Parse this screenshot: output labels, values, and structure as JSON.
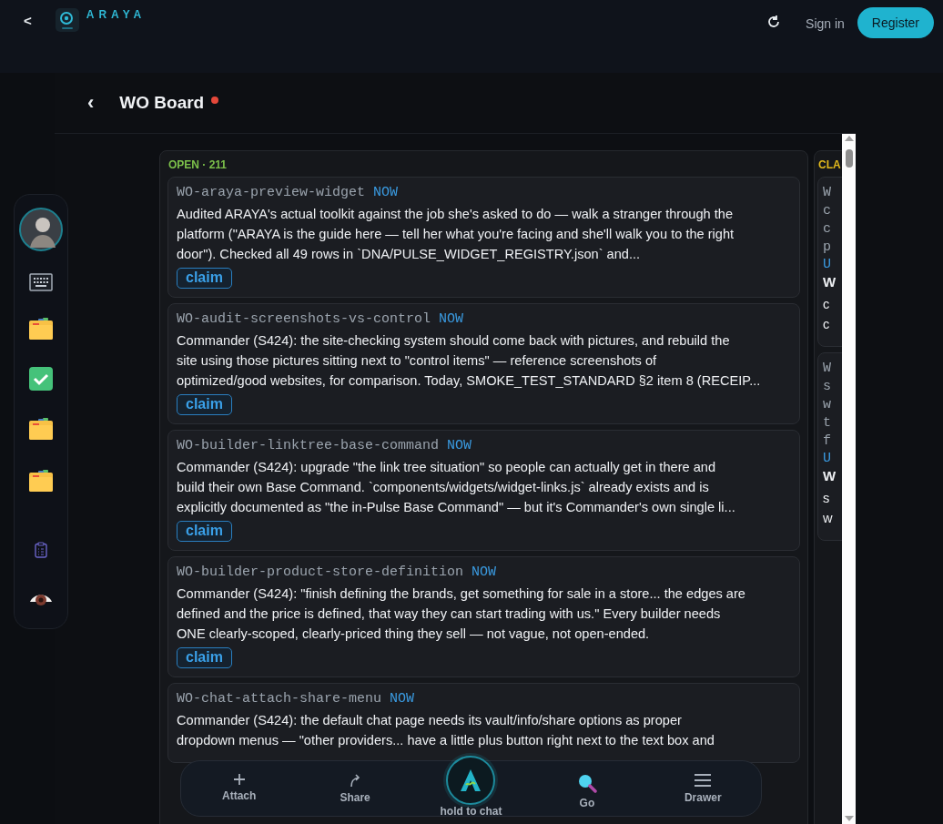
{
  "top_bar": {
    "back": "<",
    "brand": "ARAYA",
    "sign_in": "Sign in",
    "register": "Register"
  },
  "header": {
    "back": "‹",
    "title": "WO Board"
  },
  "columns": [
    {
      "label": "OPEN · 211",
      "color": "#7cc04a",
      "cards": [
        {
          "id": "WO-araya-preview-widget",
          "tag": "NOW",
          "body_lines": [
            "Audited ARAYA's actual toolkit against the job she's asked to do — walk a stranger through the",
            "platform (\"ARAYA is the guide here — tell her what you're facing and she'll walk you to the right",
            "door\"). Checked all 49 rows in `DNA/PULSE_WIDGET_REGISTRY.json` and..."
          ],
          "action": "claim"
        },
        {
          "id": "WO-audit-screenshots-vs-control",
          "tag": "NOW",
          "body_lines": [
            "Commander (S424): the site-checking system should come back with pictures, and rebuild the",
            "site using those pictures sitting next to \"control items\" — reference screenshots of",
            "optimized/good websites, for comparison. Today, SMOKE_TEST_STANDARD §2 item 8 (RECEIP..."
          ],
          "action": "claim"
        },
        {
          "id": "WO-builder-linktree-base-command",
          "tag": "NOW",
          "body_lines": [
            "Commander (S424): upgrade \"the link tree situation\" so people can actually get in there and",
            "build their own Base Command. `components/widgets/widget-links.js` already exists and is",
            "explicitly documented as \"the in-Pulse Base Command\" — but it's Commander's own single li..."
          ],
          "action": "claim"
        },
        {
          "id": "WO-builder-product-store-definition",
          "tag": "NOW",
          "body_lines": [
            "Commander (S424): \"finish defining the brands, get something for sale in a store... the edges are",
            "defined and the price is defined, that way they can start trading with us.\" Every builder needs",
            "ONE clearly-scoped, clearly-priced thing they sell — not vague, not open-ended."
          ],
          "action": "claim"
        },
        {
          "id": "WO-chat-attach-share-menu",
          "tag": "NOW",
          "body_lines": [
            "Commander (S424): the default chat page needs its vault/info/share options as proper",
            "dropdown menus — \"other providers... have a little plus button right next to the text box and"
          ]
        }
      ]
    },
    {
      "label": "CLA",
      "color": "#e0b81c",
      "cards": [
        {
          "id_lines": [
            "W",
            "c",
            "c",
            "p"
          ],
          "tag": "U",
          "title": "W",
          "body_lines": [
            "c",
            "c"
          ]
        },
        {
          "id_lines": [
            "W",
            "s",
            "w",
            "t",
            "f"
          ],
          "tag": "U",
          "title": "W",
          "body_lines": [
            "s",
            "w"
          ]
        }
      ]
    }
  ],
  "dock": [
    {
      "kind": "attach",
      "label": "Attach"
    },
    {
      "kind": "share",
      "label": "Share"
    },
    {
      "kind": "chat",
      "label": "hold to chat"
    },
    {
      "kind": "go",
      "label": "Go"
    },
    {
      "kind": "drawer",
      "label": "Drawer"
    }
  ]
}
